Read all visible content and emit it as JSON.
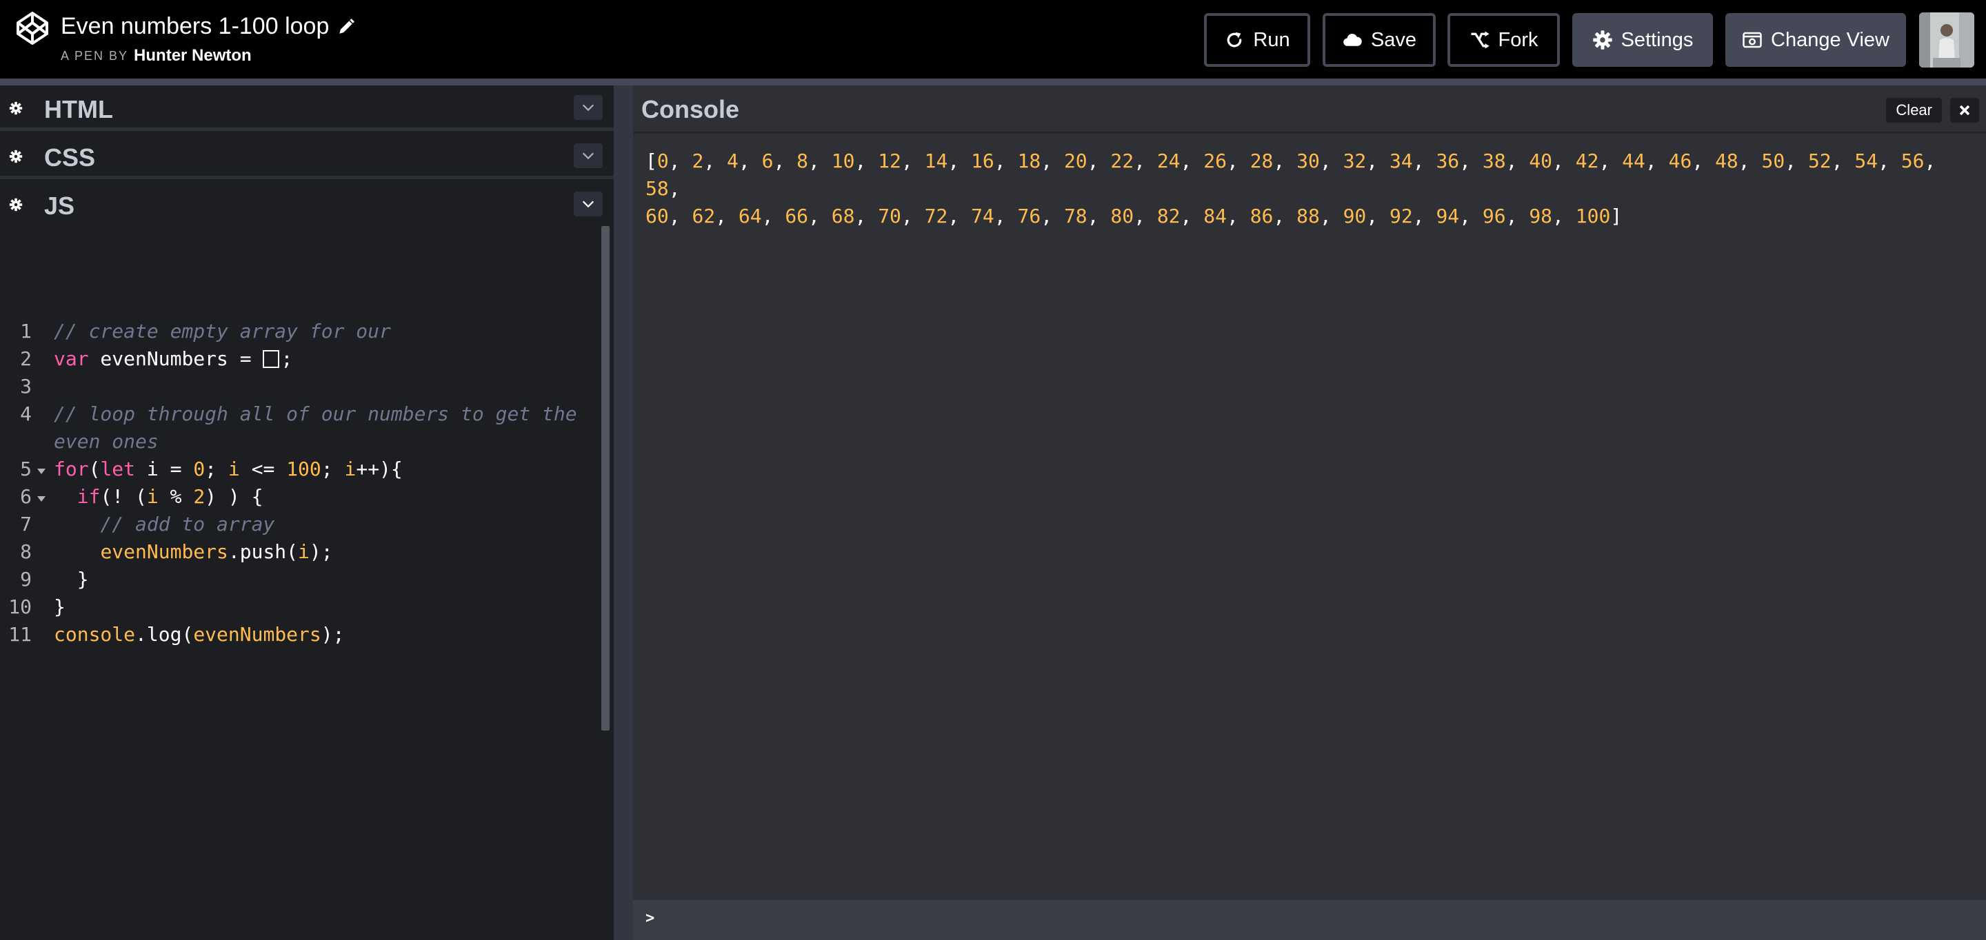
{
  "header": {
    "title": "Even numbers 1-100 loop",
    "byline_prefix": "A PEN BY",
    "author": "Hunter Newton",
    "buttons": {
      "run": "Run",
      "save": "Save",
      "fork": "Fork",
      "settings": "Settings",
      "change_view": "Change View"
    },
    "icons": {
      "logo": "codepen-logo-icon",
      "edit": "pencil-icon",
      "run": "refresh-icon",
      "save": "cloud-icon",
      "fork": "fork-icon",
      "settings": "gear-icon",
      "change_view": "change-view-icon"
    }
  },
  "editors": {
    "html": {
      "title": "HTML"
    },
    "css": {
      "title": "CSS"
    },
    "js": {
      "title": "JS"
    }
  },
  "code": {
    "line_numbers": [
      "1",
      "2",
      "3",
      "4",
      "5",
      "6",
      "7",
      "8",
      "9",
      "10",
      "11"
    ],
    "l1_comment": "// create empty array for our",
    "l2_kw": "var",
    "l2_rest": " evenNumbers = ",
    "l2_end": ";",
    "l4_comment_a": "// loop through all of our numbers to get the",
    "l4_comment_b": "even ones",
    "l5_a": "for",
    "l5_b": "(",
    "l5_c": "let",
    "l5_d": " i = ",
    "l5_e": "0",
    "l5_f": "; ",
    "l5_g": "i",
    "l5_h": " <= ",
    "l5_i": "100",
    "l5_j": "; ",
    "l5_k": "i",
    "l5_l": "++){",
    "l6_a": "  ",
    "l6_b": "if",
    "l6_c": "(! (",
    "l6_d": "i",
    "l6_e": " % ",
    "l6_f": "2",
    "l6_g": ") ) {",
    "l7_comment": "    // add to array",
    "l8_a": "    ",
    "l8_b": "evenNumbers",
    "l8_c": ".push(",
    "l8_d": "i",
    "l8_e": ");",
    "l9": "  }",
    "l10": "}",
    "l11_a": "console",
    "l11_b": ".log(",
    "l11_c": "evenNumbers",
    "l11_d": ");"
  },
  "console": {
    "title": "Console",
    "clear_label": "Clear",
    "prompt": ">",
    "output_open": "[",
    "output_close": "]",
    "output_values": [
      0,
      2,
      4,
      6,
      8,
      10,
      12,
      14,
      16,
      18,
      20,
      22,
      24,
      26,
      28,
      30,
      32,
      34,
      36,
      38,
      40,
      42,
      44,
      46,
      48,
      50,
      52,
      54,
      56,
      58,
      60,
      62,
      64,
      66,
      68,
      70,
      72,
      74,
      76,
      78,
      80,
      82,
      84,
      86,
      88,
      90,
      92,
      94,
      96,
      98,
      100
    ]
  },
  "colors": {
    "header_bg": "#000000",
    "editor_bg": "#1d1e22",
    "console_bg": "#2e3035",
    "button_gray": "#444857",
    "keyword": "#ff5dae",
    "number": "#ffbb4d"
  }
}
